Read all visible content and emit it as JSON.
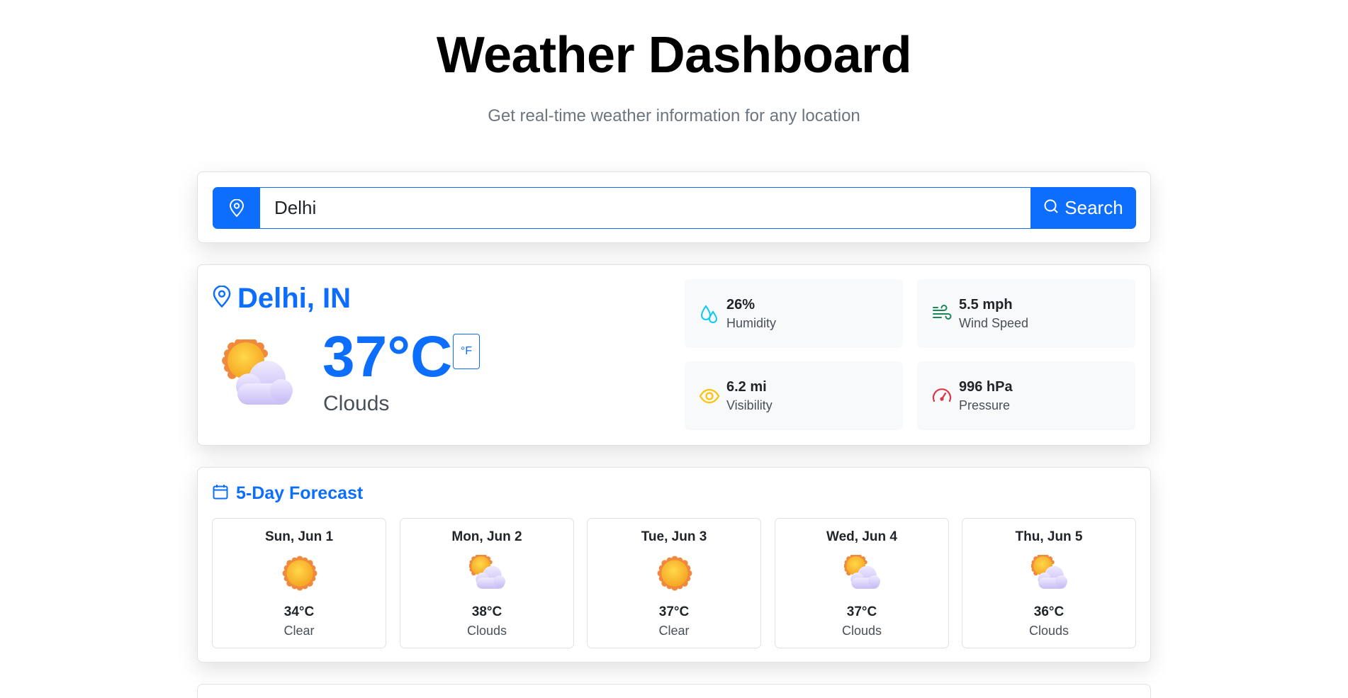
{
  "page": {
    "title": "Weather Dashboard",
    "subtitle": "Get real-time weather information for any location"
  },
  "search": {
    "value": "Delhi",
    "placeholder": "",
    "button_label": "Search"
  },
  "current": {
    "city": "Delhi, IN",
    "temperature": "37°C",
    "unit_toggle": "°F",
    "condition": "Clouds",
    "icon": "sun-behind-cloud-icon",
    "stats": [
      {
        "value": "26%",
        "label": "Humidity",
        "icon": "droplet-icon"
      },
      {
        "value": "5.5 mph",
        "label": "Wind Speed",
        "icon": "wind-icon"
      },
      {
        "value": "6.2 mi",
        "label": "Visibility",
        "icon": "eye-icon"
      },
      {
        "value": "996 hPa",
        "label": "Pressure",
        "icon": "speedometer-icon"
      }
    ]
  },
  "forecast": {
    "title": "5-Day Forecast",
    "days": [
      {
        "date": "Sun, Jun 1",
        "temp": "34°C",
        "condition": "Clear",
        "icon": "sun-icon"
      },
      {
        "date": "Mon, Jun 2",
        "temp": "38°C",
        "condition": "Clouds",
        "icon": "sun-behind-cloud-icon"
      },
      {
        "date": "Tue, Jun 3",
        "temp": "37°C",
        "condition": "Clear",
        "icon": "sun-icon"
      },
      {
        "date": "Wed, Jun 4",
        "temp": "37°C",
        "condition": "Clouds",
        "icon": "sun-behind-cloud-icon"
      },
      {
        "date": "Thu, Jun 5",
        "temp": "36°C",
        "condition": "Clouds",
        "icon": "sun-behind-cloud-icon"
      }
    ]
  },
  "colors": {
    "primary": "#0d6efd",
    "humidity": "#0dcaf0",
    "wind": "#198754",
    "visibility": "#ffc107",
    "pressure": "#dc3545"
  }
}
